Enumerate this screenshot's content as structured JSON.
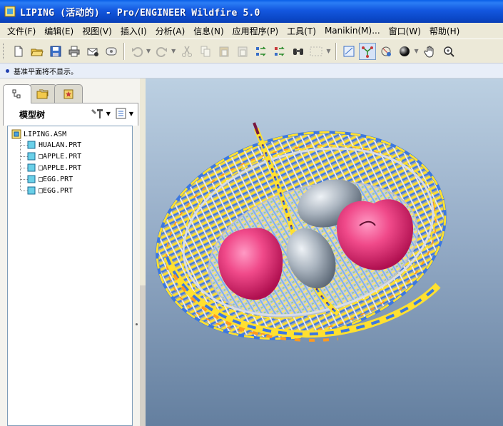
{
  "window": {
    "title": "LIPING (活动的) - Pro/ENGINEER Wildfire 5.0"
  },
  "menu": {
    "items": [
      {
        "label": "文件(F)"
      },
      {
        "label": "编辑(E)"
      },
      {
        "label": "视图(V)"
      },
      {
        "label": "插入(I)"
      },
      {
        "label": "分析(A)"
      },
      {
        "label": "信息(N)"
      },
      {
        "label": "应用程序(P)"
      },
      {
        "label": "工具(T)"
      },
      {
        "label": "Manikin(M)..."
      },
      {
        "label": "窗口(W)"
      },
      {
        "label": "帮助(H)"
      }
    ]
  },
  "toolbar": {
    "buttons": [
      {
        "name": "new-icon"
      },
      {
        "name": "open-icon"
      },
      {
        "name": "save-icon"
      },
      {
        "name": "print-icon"
      },
      {
        "name": "send-mail-icon"
      },
      {
        "name": "attach-icon"
      },
      {
        "name": "undo-icon"
      },
      {
        "name": "redo-icon"
      },
      {
        "name": "cut-icon"
      },
      {
        "name": "copy-icon"
      },
      {
        "name": "paste-icon"
      },
      {
        "name": "paste-special-icon"
      },
      {
        "name": "regenerate-icon"
      },
      {
        "name": "regen-manager-icon"
      },
      {
        "name": "find-icon"
      },
      {
        "name": "selection-box-icon"
      },
      {
        "name": "datum-display-icon"
      },
      {
        "name": "spin-center-icon"
      },
      {
        "name": "orient-icon"
      },
      {
        "name": "shading-icon"
      },
      {
        "name": "pan-hand-icon"
      },
      {
        "name": "zoom-icon"
      }
    ]
  },
  "message": {
    "text": "基准平面将不显示。"
  },
  "panel": {
    "header": "模型树"
  },
  "model_tree": {
    "root": "LIPING.ASM",
    "items": [
      {
        "label": "HUALAN.PRT"
      },
      {
        "label": "□APPLE.PRT"
      },
      {
        "label": "□APPLE.PRT"
      },
      {
        "label": "□EGG.PRT"
      },
      {
        "label": "□EGG.PRT"
      }
    ]
  },
  "colors": {
    "title_bar": "#0b48c8",
    "viewport_top": "#bcd0e2",
    "viewport_bottom": "#647f9f",
    "apple": "#f04a8a",
    "egg": "#aab4bf",
    "basket_yellow": "#ffe030",
    "basket_blue": "#3c78e0",
    "basket_orange": "#ff9a20"
  }
}
